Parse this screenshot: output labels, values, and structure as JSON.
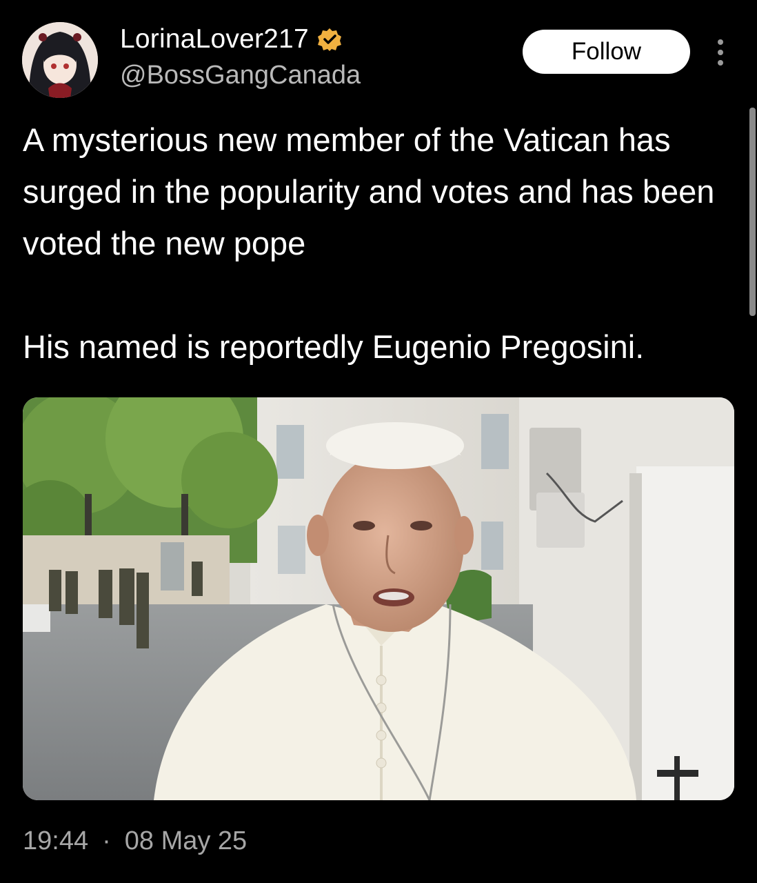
{
  "author": {
    "display_name": "LorinaLover217",
    "handle": "@BossGangCanada",
    "verified_icon": "verified-badge-icon",
    "avatar": "anime-avatar"
  },
  "actions": {
    "follow_label": "Follow",
    "more_icon": "more-vertical-icon"
  },
  "tweet": {
    "paragraphs": [
      "A mysterious new member of the Vatican has surged in the popularity and votes and has been voted the new pope",
      "His named is reportedly Eugenio Pregosini."
    ],
    "media": "photo-of-man-in-white-papal-vestments-outdoors",
    "time": "19:44",
    "date": "08 May 25"
  },
  "colors": {
    "background": "#000000",
    "text": "#ffffff",
    "secondary_text": "#b9b9b9",
    "verified_badge": "#f0b040"
  }
}
